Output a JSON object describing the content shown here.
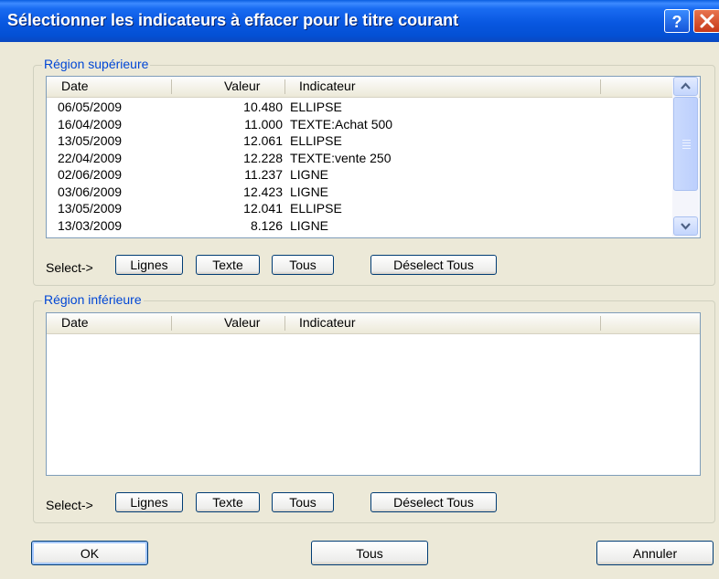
{
  "window": {
    "title": "Sélectionner les indicateurs à effacer pour le titre courant",
    "help_button": "?",
    "close_button": "×"
  },
  "columns": {
    "date": "Date",
    "value": "Valeur",
    "indicator": "Indicateur"
  },
  "upper": {
    "legend": "Région supérieure",
    "rows": [
      {
        "date": "06/05/2009",
        "value": "10.480",
        "indicator": "ELLIPSE"
      },
      {
        "date": "16/04/2009",
        "value": "11.000",
        "indicator": "TEXTE:Achat 500"
      },
      {
        "date": "13/05/2009",
        "value": "12.061",
        "indicator": "ELLIPSE"
      },
      {
        "date": "22/04/2009",
        "value": "12.228",
        "indicator": "TEXTE:vente 250"
      },
      {
        "date": "02/06/2009",
        "value": "11.237",
        "indicator": "LIGNE"
      },
      {
        "date": "03/06/2009",
        "value": "12.423",
        "indicator": "LIGNE"
      },
      {
        "date": "13/05/2009",
        "value": "12.041",
        "indicator": "ELLIPSE"
      },
      {
        "date": "13/03/2009",
        "value": "8.126",
        "indicator": "LIGNE"
      }
    ],
    "select_label": "Select->",
    "buttons": {
      "lines": "Lignes",
      "text": "Texte",
      "all": "Tous",
      "deselect_all": "Déselect Tous"
    }
  },
  "lower": {
    "legend": "Région inférieure",
    "rows": [],
    "select_label": "Select->",
    "buttons": {
      "lines": "Lignes",
      "text": "Texte",
      "all": "Tous",
      "deselect_all": "Déselect Tous"
    }
  },
  "footer": {
    "ok": "OK",
    "all": "Tous",
    "cancel": "Annuler"
  },
  "colors": {
    "title_bar": "#0857e0",
    "legend_text": "#0046d5",
    "dialog_bg": "#ece9d8",
    "list_border": "#7f9db9"
  }
}
